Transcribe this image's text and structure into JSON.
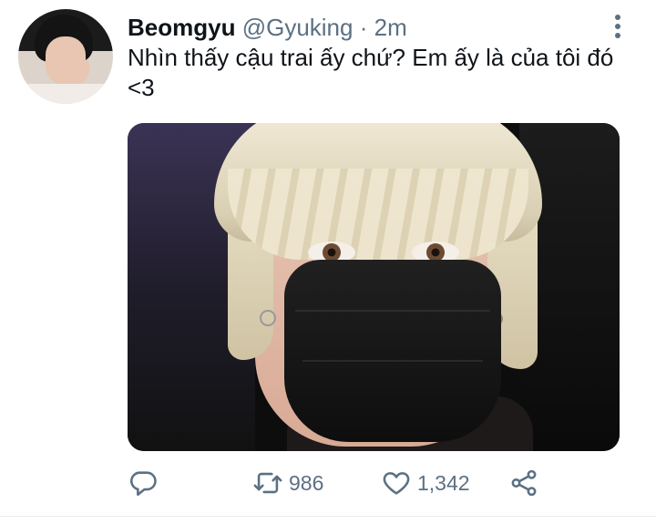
{
  "tweet": {
    "author_name": "Beomgyu",
    "handle": "@Gyuking",
    "separator": "·",
    "time": "2m",
    "text": "Nhìn thấy cậu trai ấy chứ? Em ấy là của tôi đó <3"
  },
  "actions": {
    "reply": {
      "icon": "reply-icon"
    },
    "retweet": {
      "icon": "retweet-icon",
      "count": "986"
    },
    "like": {
      "icon": "heart-icon",
      "count": "1,342"
    },
    "share": {
      "icon": "share-icon"
    }
  },
  "colors": {
    "text": "#0f1419",
    "secondary": "#5b7083",
    "divider": "#e6ecf0"
  }
}
